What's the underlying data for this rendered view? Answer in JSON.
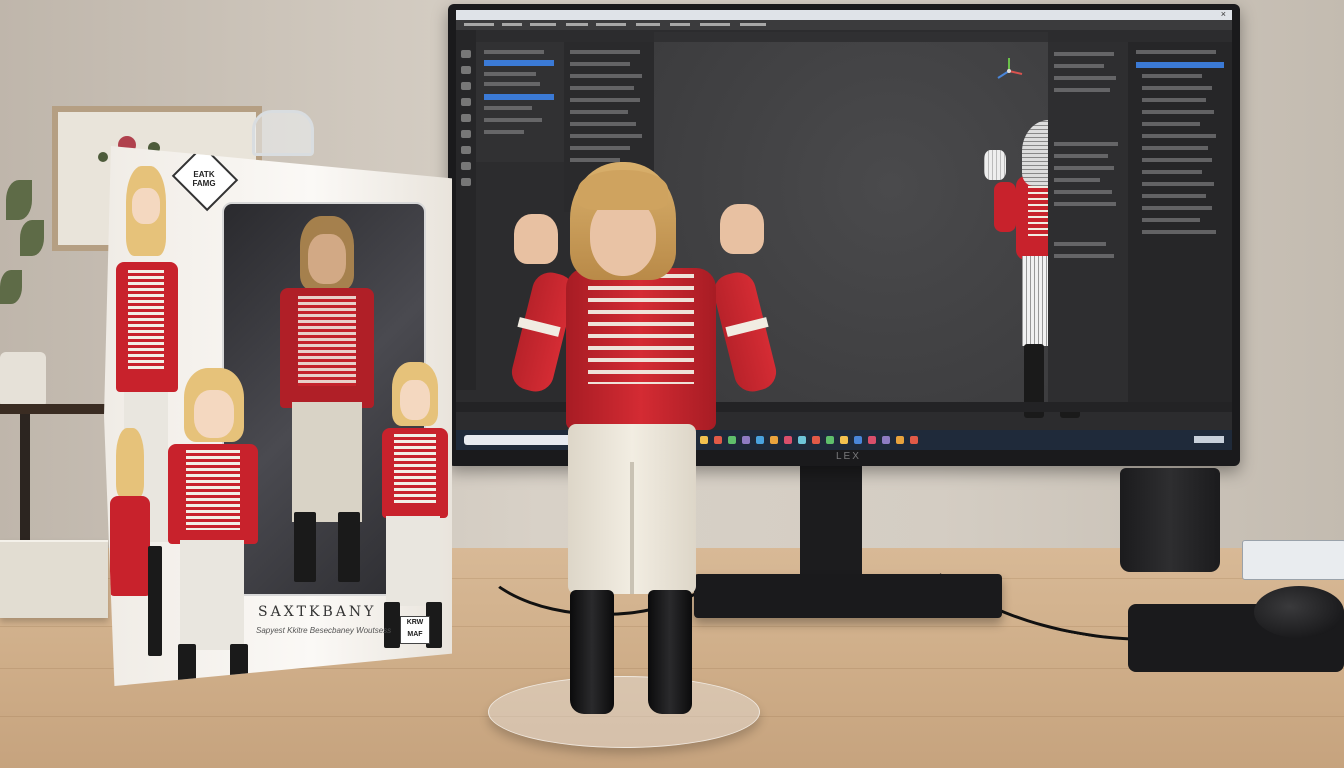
{
  "scene": {
    "description_colors": {
      "coat": "#c8222c",
      "trim": "#f1ece2",
      "boots": "#111111",
      "hair": "#d4a862",
      "screen_bg": "#2c2c2e",
      "selection": "#3b7ad6"
    }
  },
  "box": {
    "title": "SAXTKBANY",
    "subtitle": "Sapyest Kkitre Besecbaney Woutsess",
    "logo_text": "EATK FAMG",
    "badge_text": "KRW MAF"
  },
  "monitor": {
    "brand": "LEX"
  }
}
